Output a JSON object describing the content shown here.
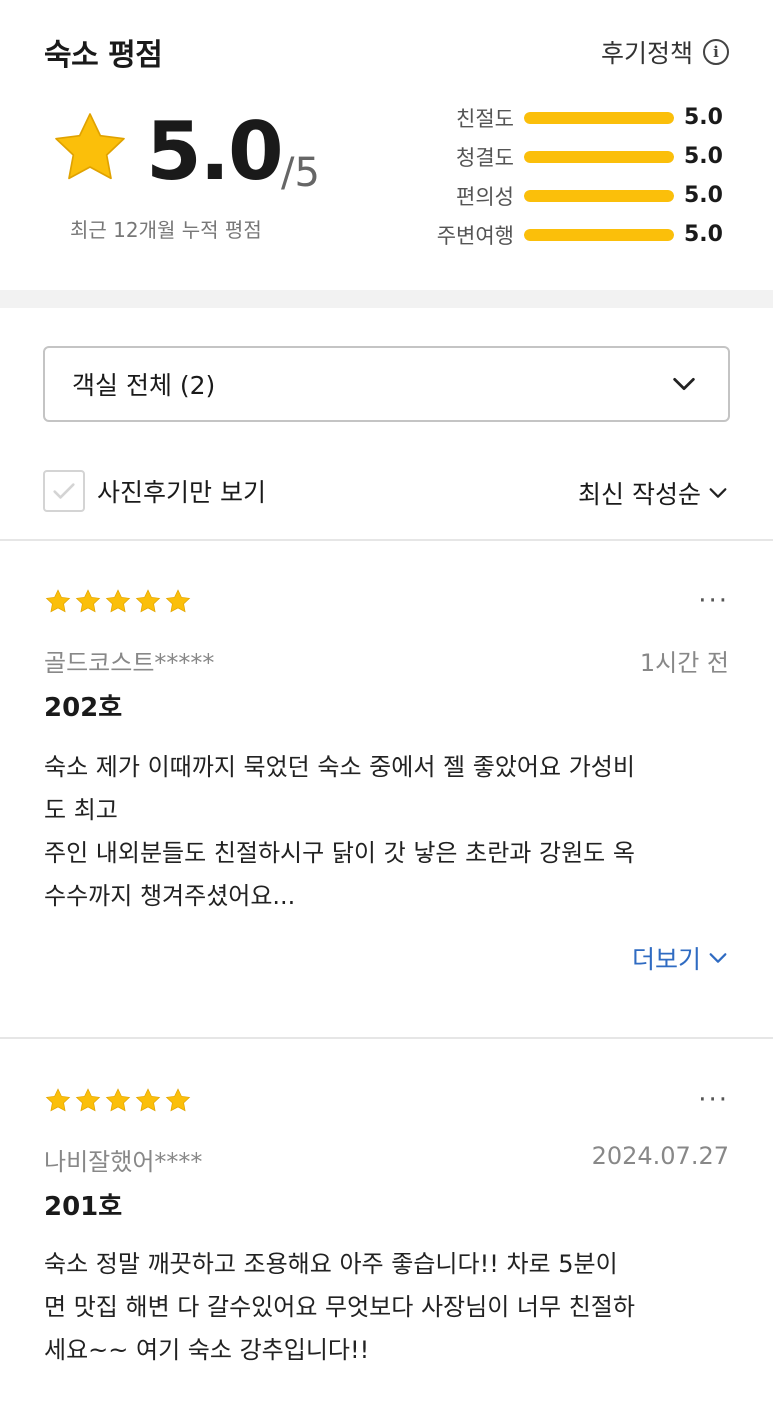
{
  "rating": {
    "title": "숙소 평점",
    "policy_label": "후기정책",
    "score": "5.0",
    "max": "/5",
    "caption": "최근 12개월 누적 평점",
    "categories": [
      {
        "label": "친절도",
        "value": "5.0",
        "fraction": 1.0
      },
      {
        "label": "청결도",
        "value": "5.0",
        "fraction": 1.0
      },
      {
        "label": "편의성",
        "value": "5.0",
        "fraction": 1.0
      },
      {
        "label": "주변여행",
        "value": "5.0",
        "fraction": 1.0
      }
    ],
    "star_color": "#fbbf0a"
  },
  "filter": {
    "room_select": "객실 전체 (2)",
    "photo_only_label": "사진후기만 보기",
    "photo_only_checked": false,
    "sort_label": "최신 작성순"
  },
  "reviews": [
    {
      "stars": 5,
      "author": "골드코스트*****",
      "date": "1시간 전",
      "room": "202호",
      "text": "숙소 제가 이때까지 묵었던 숙소 중에서 젤 좋았어요 가성비\n도 최고\n주인 내외분들도 친절하시구 닭이 갓 낳은 초란과 강원도 옥\n수수까지 챙겨주셨어요...",
      "more_label": "더보기",
      "menu": "···"
    },
    {
      "stars": 5,
      "author": "나비잘했어****",
      "date": "2024.07.27",
      "room": "201호",
      "text": "숙소 정말 깨끗하고 조용해요 아주 좋습니다!! 차로 5분이\n면 맛집 해변 다 갈수있어요 무엇보다 사장님이 너무 친절하\n세요~~ 여기 숙소 강추입니다!!",
      "menu": "···"
    }
  ]
}
